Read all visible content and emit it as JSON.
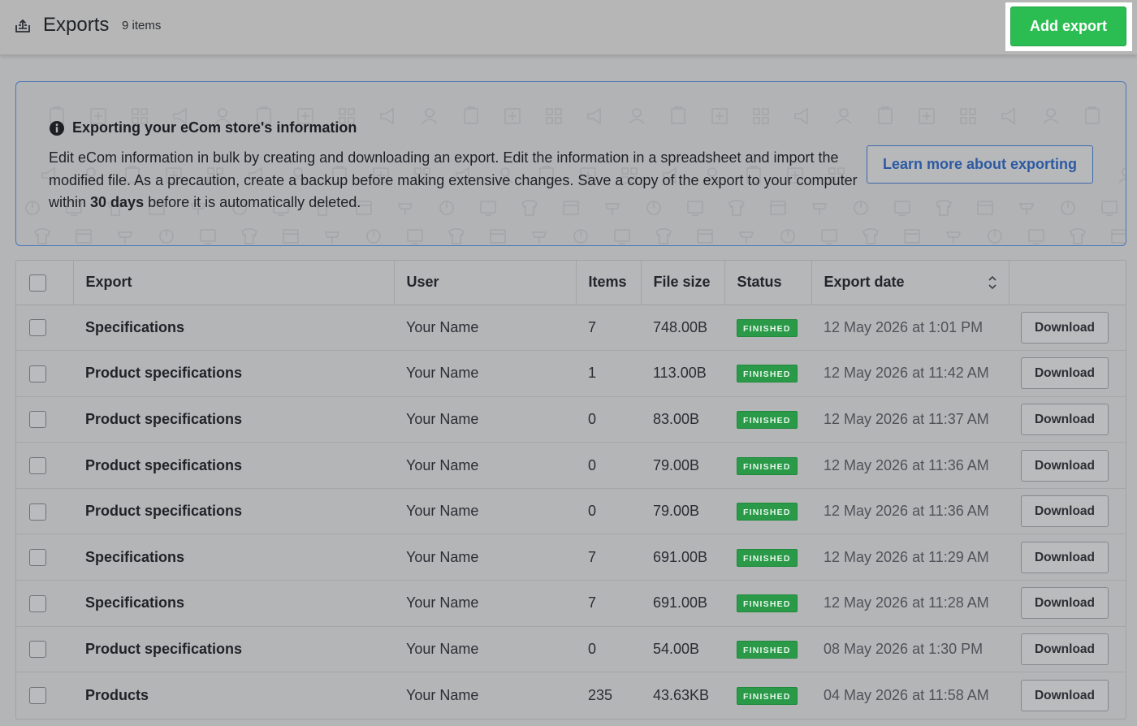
{
  "header": {
    "title": "Exports",
    "count": "9 items",
    "add_button": "Add export"
  },
  "banner": {
    "heading": "Exporting your eCom store's information",
    "text_part1": "Edit eCom information in bulk by creating and downloading an export. Edit the information in a spreadsheet and import the modified file. As a precaution, create a backup before making extensive changes. Save a copy of the export to your computer within ",
    "text_bold": "30 days",
    "text_part2": " before it is automatically deleted.",
    "learn_button": "Learn more about exporting"
  },
  "table": {
    "columns": [
      "Export",
      "User",
      "Items",
      "File size",
      "Status",
      "Export date"
    ],
    "rows": [
      {
        "export": "Specifications",
        "user": "Your Name",
        "items": "7",
        "size": "748.00B",
        "status": "FINISHED",
        "date": "12 May 2026 at 1:01 PM",
        "action": "Download"
      },
      {
        "export": "Product specifications",
        "user": "Your Name",
        "items": "1",
        "size": "113.00B",
        "status": "FINISHED",
        "date": "12 May 2026 at 11:42 AM",
        "action": "Download"
      },
      {
        "export": "Product specifications",
        "user": "Your Name",
        "items": "0",
        "size": "83.00B",
        "status": "FINISHED",
        "date": "12 May 2026 at 11:37 AM",
        "action": "Download"
      },
      {
        "export": "Product specifications",
        "user": "Your Name",
        "items": "0",
        "size": "79.00B",
        "status": "FINISHED",
        "date": "12 May 2026 at 11:36 AM",
        "action": "Download"
      },
      {
        "export": "Product specifications",
        "user": "Your Name",
        "items": "0",
        "size": "79.00B",
        "status": "FINISHED",
        "date": "12 May 2026 at 11:36 AM",
        "action": "Download"
      },
      {
        "export": "Specifications",
        "user": "Your Name",
        "items": "7",
        "size": "691.00B",
        "status": "FINISHED",
        "date": "12 May 2026 at 11:29 AM",
        "action": "Download"
      },
      {
        "export": "Specifications",
        "user": "Your Name",
        "items": "7",
        "size": "691.00B",
        "status": "FINISHED",
        "date": "12 May 2026 at 11:28 AM",
        "action": "Download"
      },
      {
        "export": "Product specifications",
        "user": "Your Name",
        "items": "0",
        "size": "54.00B",
        "status": "FINISHED",
        "date": "08 May 2026 at 1:30 PM",
        "action": "Download"
      },
      {
        "export": "Products",
        "user": "Your Name",
        "items": "235",
        "size": "43.63KB",
        "status": "FINISHED",
        "date": "04 May 2026 at 11:58 AM",
        "action": "Download"
      }
    ]
  },
  "icons": {
    "header": "export-tray-icon",
    "banner": "info-circle-icon",
    "sort": "sort-updown-icon"
  },
  "colors": {
    "accent_green": "#2cbd52",
    "link_blue": "#2d5aa3",
    "status_green": "#2a9a48"
  }
}
